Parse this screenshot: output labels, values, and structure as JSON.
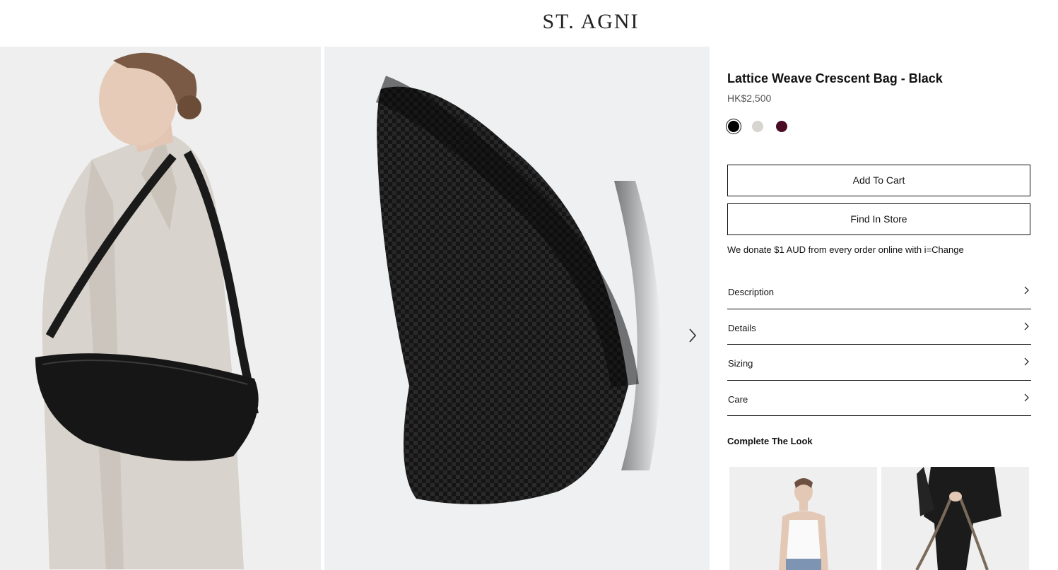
{
  "brand": {
    "logo_text": "ST. AGNI"
  },
  "gallery": {
    "images": [
      {
        "alt": "Model wearing bag on shoulder"
      },
      {
        "alt": "Bag side view"
      }
    ],
    "next_icon": "chevron-right-icon"
  },
  "product": {
    "title": "Lattice Weave Crescent Bag - Black",
    "price": "HK$2,500",
    "swatches": [
      {
        "color": "#000000",
        "selected": true
      },
      {
        "color": "#d8d4cf",
        "selected": false
      },
      {
        "color": "#4a0c24",
        "selected": false
      }
    ]
  },
  "actions": {
    "add_to_cart": "Add To Cart",
    "find_in_store": "Find In Store"
  },
  "donation_text": "We donate $1 AUD from every order online with i=Change",
  "accordion": [
    {
      "label": "Description"
    },
    {
      "label": "Details"
    },
    {
      "label": "Sizing"
    },
    {
      "label": "Care"
    }
  ],
  "complete_the_look": {
    "title": "Complete The Look",
    "items": [
      {
        "alt": "Model in white tank top"
      },
      {
        "alt": "Model holding bag"
      }
    ]
  }
}
